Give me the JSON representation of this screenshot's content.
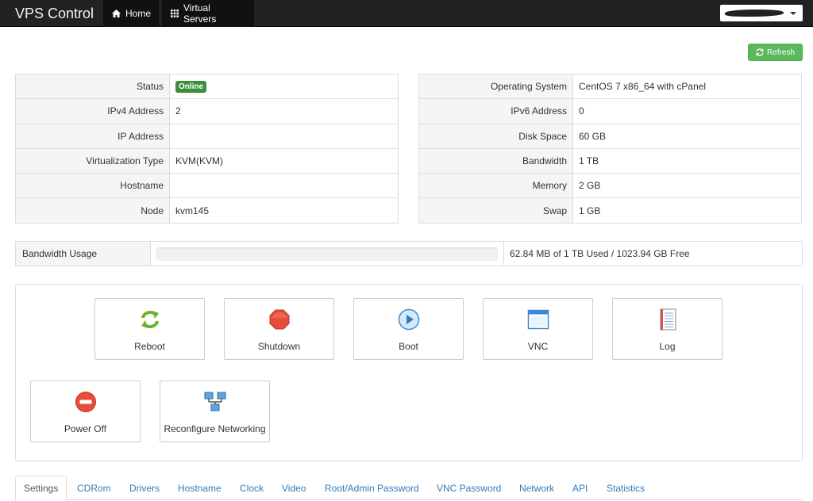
{
  "navbar": {
    "brand": "VPS Control",
    "home_label": "Home",
    "virtual_servers_label": "Virtual Servers"
  },
  "toolbar": {
    "refresh_label": "Refresh"
  },
  "info_left": [
    {
      "label": "Status",
      "value": "Online",
      "type": "badge"
    },
    {
      "label": "IPv4 Address",
      "value": "2"
    },
    {
      "label": "IP Address",
      "value": ""
    },
    {
      "label": "Virtualization Type",
      "value": "KVM(KVM)"
    },
    {
      "label": "Hostname",
      "value": ""
    },
    {
      "label": "Node",
      "value": "kvm145"
    }
  ],
  "info_right": [
    {
      "label": "Operating System",
      "value": "CentOS 7 x86_64 with cPanel"
    },
    {
      "label": "IPv6 Address",
      "value": "0"
    },
    {
      "label": "Disk Space",
      "value": "60 GB"
    },
    {
      "label": "Bandwidth",
      "value": "1 TB"
    },
    {
      "label": "Memory",
      "value": "2 GB"
    },
    {
      "label": "Swap",
      "value": "1 GB"
    }
  ],
  "bandwidth": {
    "label": "Bandwidth Usage",
    "usage_text": "62.84 MB of 1 TB Used / 1023.94 GB Free",
    "used_fraction": 0.0001
  },
  "actions": {
    "reboot": "Reboot",
    "shutdown": "Shutdown",
    "boot": "Boot",
    "vnc": "VNC",
    "log": "Log",
    "power_off": "Power Off",
    "reconfigure_networking": "Reconfigure Networking"
  },
  "tabs": [
    "Settings",
    "CDRom",
    "Drivers",
    "Hostname",
    "Clock",
    "Video",
    "Root/Admin Password",
    "VNC Password",
    "Network",
    "API",
    "Statistics"
  ],
  "colors": {
    "navbar_bg": "#222222",
    "success": "#5cb85c",
    "link": "#337ab7",
    "danger": "#e74c3c"
  }
}
